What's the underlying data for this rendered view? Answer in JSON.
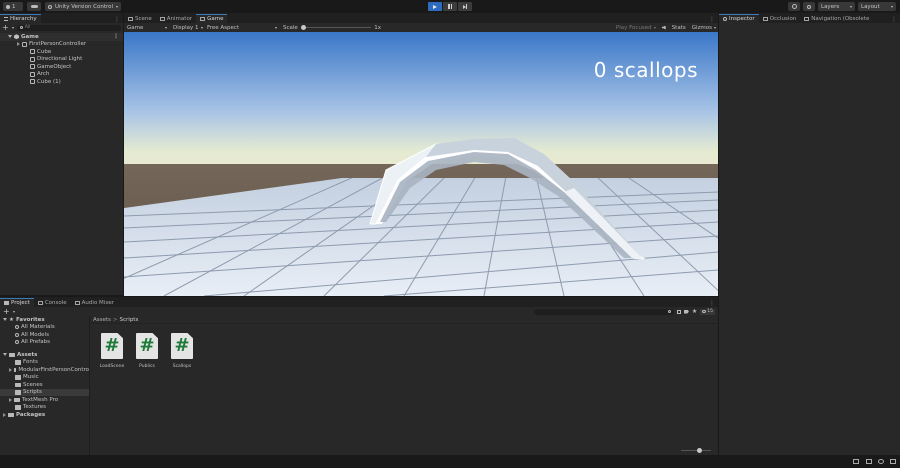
{
  "toolbar": {
    "account_label": "1",
    "version_control_label": "Unity Version Control",
    "layers_label": "Layers",
    "layout_label": "Layout"
  },
  "hierarchy": {
    "tab_label": "Hierarchy",
    "search_placeholder": "All",
    "scene_name": "Game",
    "items": [
      "FirstPersonController",
      "Cube",
      "Directional Light",
      "GameObject",
      "Arch",
      "Cube (1)"
    ]
  },
  "center_tabs": [
    "Scene",
    "Animator",
    "Game"
  ],
  "game_bar": {
    "display_mode": "Game",
    "display": "Display 1",
    "aspect": "Free Aspect",
    "scale_label": "Scale",
    "scale_value": "1x",
    "play_focused": "Play Focused",
    "stats": "Stats",
    "gizmos": "Gizmos"
  },
  "hud": {
    "score_text": "0 scallops"
  },
  "inspector_tabs": [
    "Inspector",
    "Occlusion",
    "Navigation (Obsolete"
  ],
  "bottom_tabs": [
    "Project",
    "Console",
    "Audio Mixer"
  ],
  "project": {
    "favorites_label": "Favorites",
    "favorites": [
      "All Materials",
      "All Models",
      "All Prefabs"
    ],
    "assets_label": "Assets",
    "asset_folders": [
      "Fonts",
      "ModularFirstPersonContro",
      "Music",
      "Scenes",
      "Scripts",
      "TextMesh Pro",
      "Textures"
    ],
    "packages_label": "Packages",
    "breadcrumb": [
      "Assets",
      "Scripts"
    ],
    "breadcrumb_sep": ">",
    "files": [
      "LoadScene",
      "Publics",
      "Scallops"
    ],
    "file_glyph": "#",
    "hidden_count": "15"
  },
  "colors": {
    "play_active": "#2d6bbf",
    "panel_bg": "#282828",
    "script_hash": "#1f7a3a",
    "selection": "#2c5d87"
  }
}
